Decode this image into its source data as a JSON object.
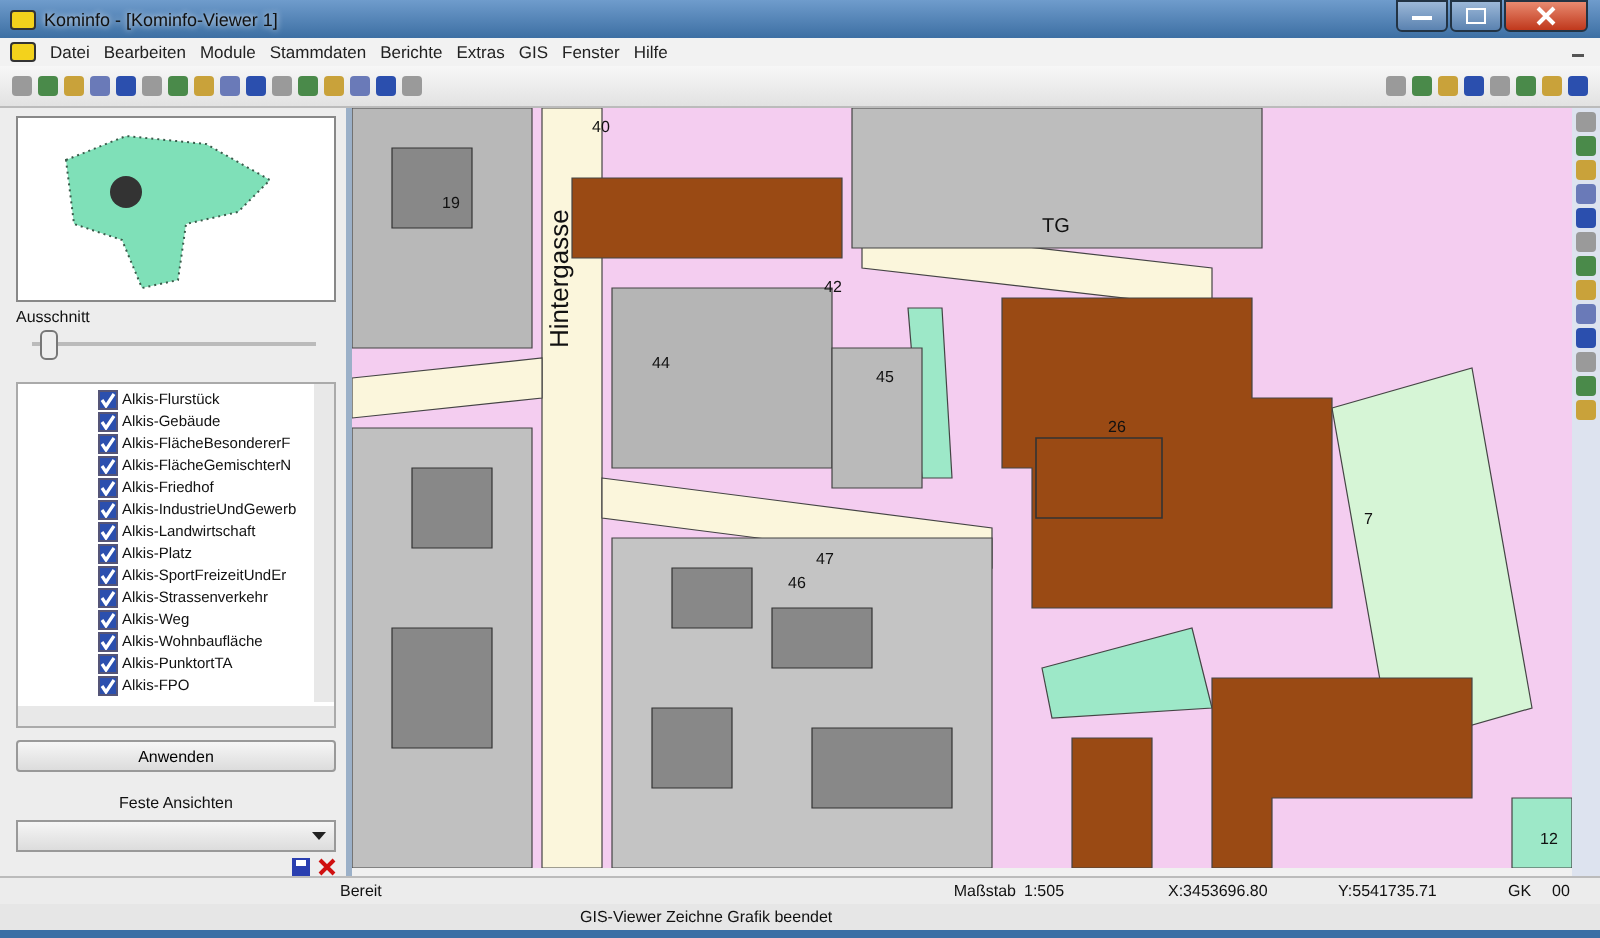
{
  "window": {
    "title": "Kominfo - [Kominfo-Viewer 1]"
  },
  "menu": [
    "Datei",
    "Bearbeiten",
    "Module",
    "Stammdaten",
    "Berichte",
    "Extras",
    "GIS",
    "Fenster",
    "Hilfe"
  ],
  "overview": {
    "label": "Ausschnitt",
    "level": 0.03
  },
  "layers": [
    {
      "label": "Alkis-Flurstück",
      "checked": true
    },
    {
      "label": "Alkis-Gebäude",
      "checked": true
    },
    {
      "label": "Alkis-FlächeBesondererF",
      "checked": true
    },
    {
      "label": "Alkis-FlächeGemischterN",
      "checked": true
    },
    {
      "label": "Alkis-Friedhof",
      "checked": true
    },
    {
      "label": "Alkis-IndustrieUndGewerb",
      "checked": true
    },
    {
      "label": "Alkis-Landwirtschaft",
      "checked": true
    },
    {
      "label": "Alkis-Platz",
      "checked": true
    },
    {
      "label": "Alkis-SportFreizeitUndEr",
      "checked": true
    },
    {
      "label": "Alkis-Strassenverkehr",
      "checked": true
    },
    {
      "label": "Alkis-Weg",
      "checked": true
    },
    {
      "label": "Alkis-Wohnbaufläche",
      "checked": true
    },
    {
      "label": "Alkis-PunktortTA",
      "checked": true
    },
    {
      "label": "Alkis-FPO",
      "checked": true
    }
  ],
  "apply_button": "Anwenden",
  "fixed_views": {
    "label": "Feste Ansichten"
  },
  "map": {
    "labels": [
      "Hintergasse",
      "TG",
      "40",
      "19",
      "42",
      "44",
      "45",
      "47",
      "46",
      "26",
      "12",
      "7"
    ]
  },
  "status_bar": {
    "state": "Bereit",
    "scale_label": "Maßstab",
    "scale": "1:505",
    "x": "X:3453696.80",
    "y": "Y:5541735.71",
    "system": "GK",
    "zone": "00"
  },
  "message": "GIS-Viewer Zeichne Grafik beendet"
}
